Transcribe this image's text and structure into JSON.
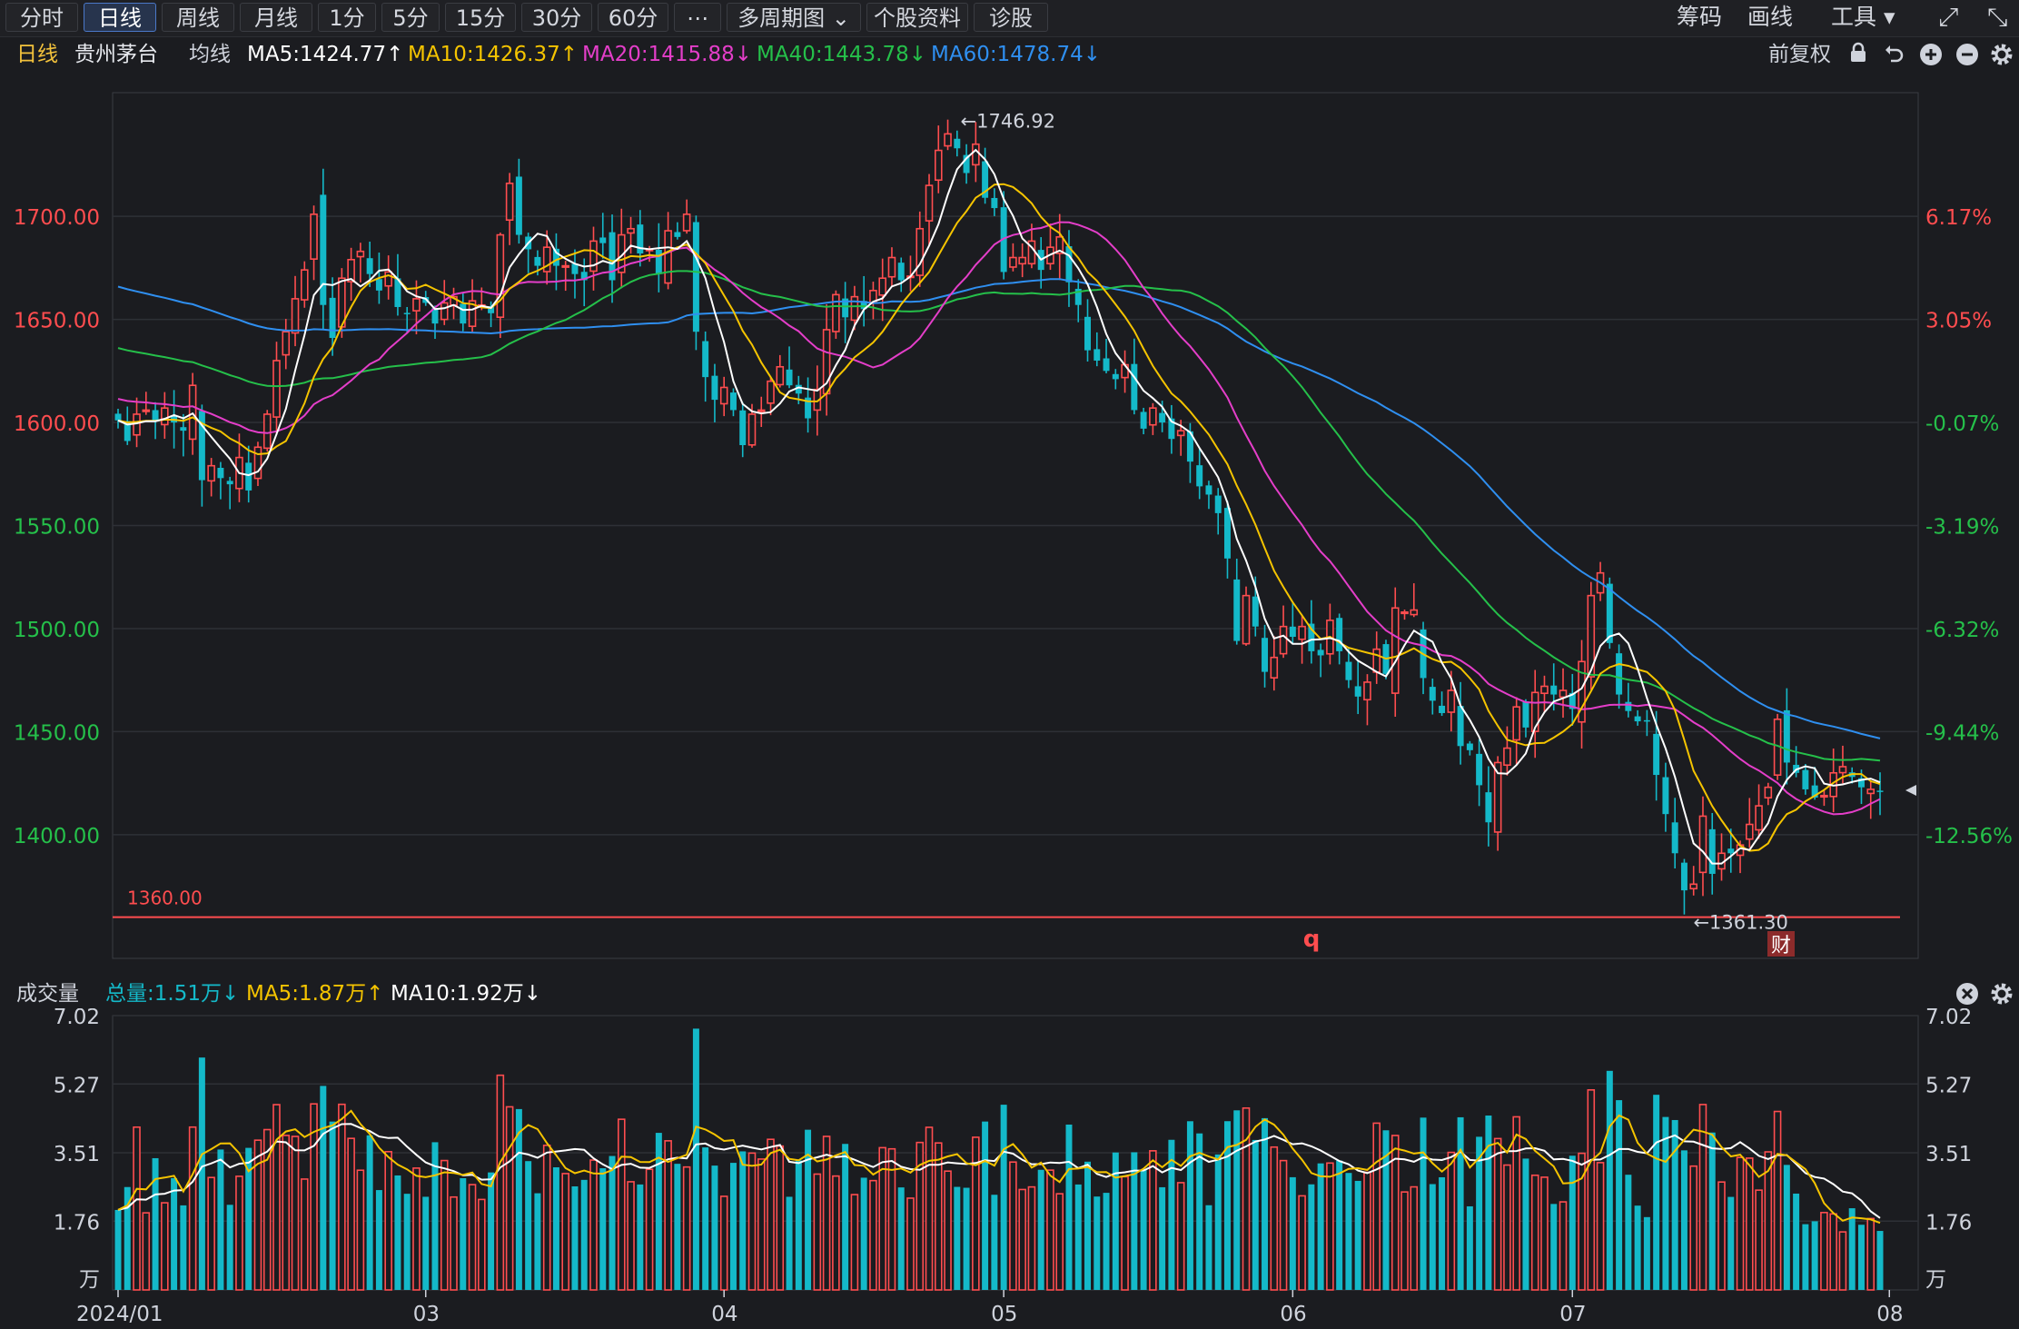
{
  "toolbar": {
    "left_buttons": [
      "分时",
      "日线",
      "周线",
      "月线",
      "1分",
      "5分",
      "15分",
      "30分",
      "60分",
      "⋯",
      "多周期图 ⌄",
      "个股资料",
      "诊股"
    ],
    "active": "日线",
    "chips": "筹码",
    "draw": "画线",
    "tools": "工具 ▾",
    "expand_icon": "⤢",
    "collapse_icon": "⤡"
  },
  "info": {
    "period": "日线",
    "stock_name": "贵州茅台",
    "ma_label": "均线",
    "ma5": "MA5:1424.77↑",
    "ma10": "MA10:1426.37↑",
    "ma20": "MA20:1415.88↓",
    "ma40": "MA40:1443.78↓",
    "ma60": "MA60:1478.74↓",
    "adjust": "前复权"
  },
  "volume_info": {
    "label": "成交量",
    "total": "总量:1.51万↓",
    "ma5": "MA5:1.87万↑",
    "ma10": "MA10:1.92万↓"
  },
  "colors": {
    "up": "#ff4d4f",
    "down": "#14b9c9",
    "ma5": "#ffffff",
    "ma10": "#f5c400",
    "ma20": "#e43ec9",
    "ma40": "#25c04a",
    "ma60": "#2f8ff0",
    "grid": "#2e3036",
    "background": "#1b1c20"
  },
  "chart_data": [
    {
      "type": "candlestick",
      "title": "贵州茅台 日线",
      "price_axis": {
        "ticks": [
          "1700.00",
          "1650.00",
          "1600.00",
          "1550.00",
          "1500.00",
          "1450.00",
          "1400.00"
        ],
        "range": [
          1340,
          1760
        ]
      },
      "percent_axis": {
        "ticks": [
          "6.17%",
          "3.05%",
          "-0.07%",
          "-3.19%",
          "-6.32%",
          "-9.44%",
          "-12.56%"
        ]
      },
      "x_labels": [
        "2024/01",
        "03",
        "04",
        "05",
        "06",
        "07",
        "08"
      ],
      "x_label_day_index": [
        0,
        33,
        65,
        95,
        126,
        156,
        190
      ],
      "annotations": {
        "high_label": "←1746.92",
        "low_label": "←1361.30",
        "alert_line_label": "1360.00",
        "alert_line_value": 1360,
        "marker_q": "q",
        "marker_cai": "财"
      },
      "closes": [
        1601,
        1591,
        1604,
        1606,
        1601,
        1607,
        1600,
        1596,
        1618,
        1572,
        1579,
        1573,
        1570,
        1583,
        1567,
        1588,
        1604,
        1630,
        1644,
        1660,
        1674,
        1701,
        1657,
        1641,
        1670,
        1679,
        1683,
        1672,
        1664,
        1673,
        1656,
        1653,
        1660,
        1658,
        1648,
        1658,
        1661,
        1648,
        1659,
        1657,
        1653,
        1691,
        1716,
        1691,
        1684,
        1676,
        1685,
        1676,
        1676,
        1672,
        1669,
        1688,
        1687,
        1669,
        1691,
        1694,
        1682,
        1684,
        1672,
        1693,
        1690,
        1701,
        1644,
        1622,
        1611,
        1617,
        1606,
        1589,
        1604,
        1606,
        1620,
        1627,
        1618,
        1614,
        1602,
        1616,
        1645,
        1662,
        1651,
        1661,
        1655,
        1664,
        1670,
        1680,
        1669,
        1671,
        1694,
        1715,
        1732,
        1740,
        1733,
        1721,
        1735,
        1709,
        1704,
        1673,
        1680,
        1680,
        1688,
        1674,
        1685,
        1690,
        1668,
        1657,
        1635,
        1630,
        1625,
        1621,
        1628,
        1606,
        1597,
        1607,
        1600,
        1592,
        1596,
        1581,
        1569,
        1565,
        1556,
        1534,
        1494,
        1516,
        1501,
        1479,
        1486,
        1501,
        1496,
        1501,
        1489,
        1487,
        1504,
        1489,
        1475,
        1467,
        1474,
        1490,
        1478,
        1510,
        1508,
        1509,
        1476,
        1465,
        1459,
        1470,
        1443,
        1441,
        1424,
        1406,
        1435,
        1442,
        1462,
        1452,
        1469,
        1472,
        1468,
        1470,
        1461,
        1484,
        1516,
        1527,
        1493,
        1468,
        1460,
        1455,
        1455,
        1429,
        1410,
        1391,
        1373,
        1376,
        1409,
        1381,
        1391,
        1391,
        1395,
        1405,
        1414,
        1423,
        1456,
        1435,
        1430,
        1422,
        1418,
        1419,
        1430,
        1433,
        1428,
        1423,
        1422,
        1421
      ],
      "ma_final": {
        "MA5": 1424.77,
        "MA10": 1426.37,
        "MA20": 1415.88,
        "MA40": 1443.78,
        "MA60": 1478.74
      },
      "ma60_start": 1667,
      "ma40_start": 1637
    },
    {
      "type": "bar",
      "title": "成交量",
      "unit": "万",
      "y_ticks": [
        "7.02",
        "5.27",
        "3.51",
        "1.76",
        "万"
      ],
      "y_range": [
        0,
        7.02
      ],
      "volume_final": 1.51
    }
  ]
}
